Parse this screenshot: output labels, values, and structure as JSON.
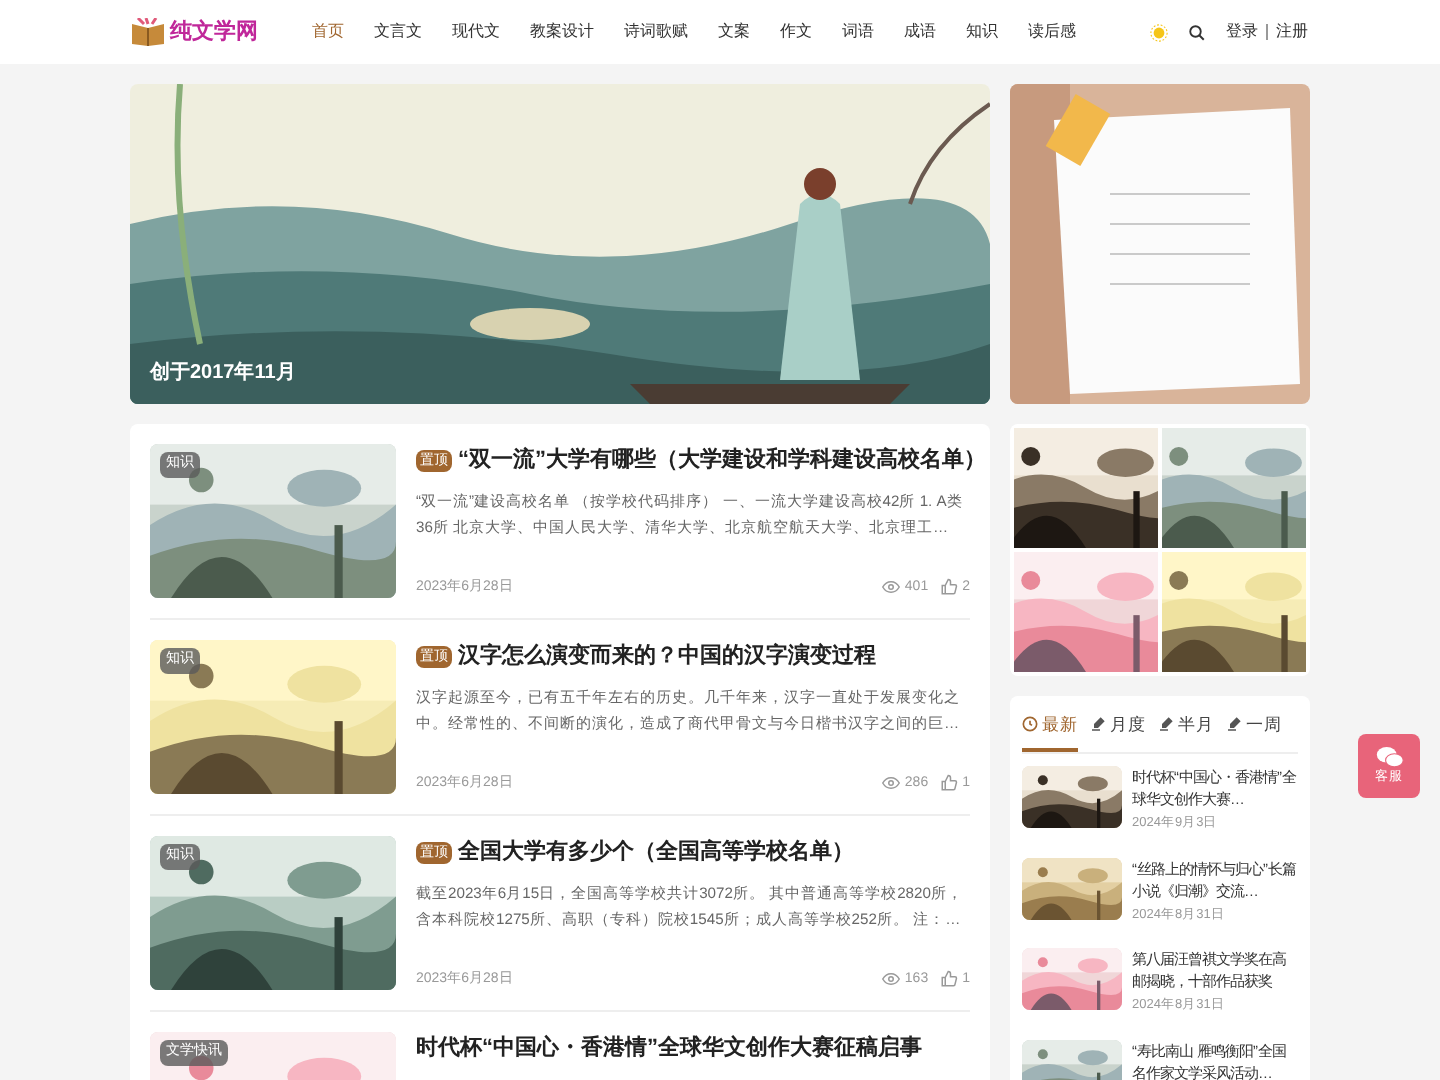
{
  "header": {
    "logo": "纯文学网",
    "nav": [
      {
        "label": "首页",
        "selected": true
      },
      {
        "label": "文言文",
        "selected": false
      },
      {
        "label": "现代文",
        "selected": false
      },
      {
        "label": "教案设计",
        "selected": false
      },
      {
        "label": "诗词歌赋",
        "selected": false
      },
      {
        "label": "文案",
        "selected": false
      },
      {
        "label": "作文",
        "selected": false
      },
      {
        "label": "词语",
        "selected": false
      },
      {
        "label": "成语",
        "selected": false
      },
      {
        "label": "知识",
        "selected": false
      },
      {
        "label": "读后感",
        "selected": false
      }
    ],
    "login": "登录",
    "register": "注册"
  },
  "banner": {
    "caption": "创于2017年11月"
  },
  "articles": [
    {
      "category": "知识",
      "badge": "置顶",
      "title": "“双一流”大学有哪些（大学建设和学科建设高校名单）",
      "excerpt": "“双一流”建设高校名单 （按学校代码排序） 一、一流大学建设高校42所 1. A类36所 北京大学、中国人民大学、清华大学、北京航空航天大学、北京理工…",
      "date": "2023年6月28日",
      "views": "401",
      "likes": "2"
    },
    {
      "category": "知识",
      "badge": "置顶",
      "title": "汉字怎么演变而来的？中国的汉字演变过程",
      "excerpt": "汉字起源至今，已有五千年左右的历史。几千年来，汉字一直处于发展变化之中。经常性的、不间断的演化，造成了商代甲骨文与今日楷书汉字之间的巨…",
      "date": "2023年6月28日",
      "views": "286",
      "likes": "1"
    },
    {
      "category": "知识",
      "badge": "置顶",
      "title": "全国大学有多少个（全国高等学校名单）",
      "excerpt": "截至2023年6月15日，全国高等学校共计3072所。 其中普通高等学校2820所，含本科院校1275所、高职（专科）院校1545所；成人高等学校252所。 注：…",
      "date": "2023年6月28日",
      "views": "163",
      "likes": "1"
    },
    {
      "category": "文学快讯",
      "title": "时代杯“中国心・香港情”全球华文创作大赛征稿启事"
    }
  ],
  "tabs": [
    {
      "label": "最新",
      "selected": true
    },
    {
      "label": "月度",
      "selected": false
    },
    {
      "label": "半月",
      "selected": false
    },
    {
      "label": "一周",
      "selected": false
    }
  ],
  "hot": [
    {
      "title": "时代杯“中国心・香港情”全球华文创作大赛…",
      "date": "2024年9月3日"
    },
    {
      "title": "“丝路上的情怀与归心”长篇小说《归潮》交流…",
      "date": "2024年8月31日"
    },
    {
      "title": "第八届汪曾祺文学奖在高邮揭晓，十部作品获奖",
      "date": "2024年8月31日"
    },
    {
      "title": "“寿比南山 雁鸣衡阳”全国名作家文学采风活动…"
    }
  ],
  "service": "客服"
}
